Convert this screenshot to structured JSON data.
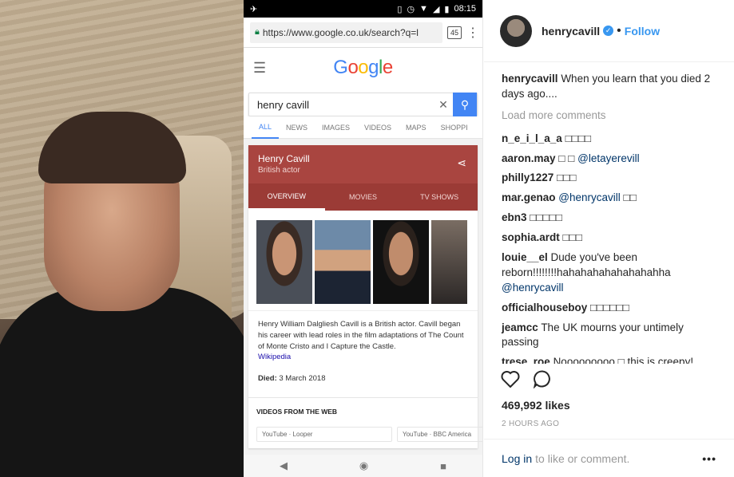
{
  "phone": {
    "status_time": "08:15",
    "tab_count": "45",
    "url": "https://www.google.co.uk/search?q=l",
    "search_query": "henry cavill",
    "tabs": [
      "ALL",
      "NEWS",
      "IMAGES",
      "VIDEOS",
      "MAPS",
      "SHOPPI"
    ],
    "kp_name": "Henry Cavill",
    "kp_subtitle": "British actor",
    "kp_tabs": [
      "OVERVIEW",
      "MOVIES",
      "TV SHOWS"
    ],
    "kp_description": "Henry William Dalgliesh Cavill is a British actor. Cavill began his career with lead roles in the film adaptations of The Count of Monte Cristo and I Capture the Castle.",
    "kp_wiki": "Wikipedia",
    "kp_died_label": "Died:",
    "kp_died_value": " 3 March 2018",
    "videos_heading": "VIDEOS FROM THE WEB",
    "video_sources": [
      "YouTube · Looper",
      "YouTube · BBC America"
    ]
  },
  "instagram": {
    "username": "henrycavill",
    "follow_label": "Follow",
    "caption_user": "henrycavill",
    "caption_text": "When you learn that you died 2 days ago....",
    "load_more": "Load more comments",
    "comments": [
      {
        "user": "n_e_i_l_a_a",
        "text": "□□□□",
        "mention": ""
      },
      {
        "user": "aaron.may",
        "text": "□ □",
        "mention": "@letayerevill"
      },
      {
        "user": "philly1227",
        "text": "□□□",
        "mention": ""
      },
      {
        "user": "mar.genao",
        "text": "",
        "mention": "@henrycavill",
        "after": "□□"
      },
      {
        "user": "ebn3",
        "text": "□□□□□",
        "mention": ""
      },
      {
        "user": "sophia.ardt",
        "text": "□□□",
        "mention": ""
      },
      {
        "user": "louie__el",
        "text": "Dude you've been reborn!!!!!!!!hahahahahahahahahha",
        "mention": "@henrycavill"
      },
      {
        "user": "officialhouseboy",
        "text": "□□□□□□",
        "mention": ""
      },
      {
        "user": "jeamcc",
        "text": "The UK mourns your untimely passing",
        "mention": ""
      },
      {
        "user": "trese_roe",
        "text": "Nooooooooo □ this is creepy! Good to see you alive and healthy ❤□",
        "mention": ""
      }
    ],
    "likes": "469,992 likes",
    "timestamp": "2 HOURS AGO",
    "login_link": "Log in",
    "login_suffix": "to like or comment.",
    "more_label": "•••"
  }
}
